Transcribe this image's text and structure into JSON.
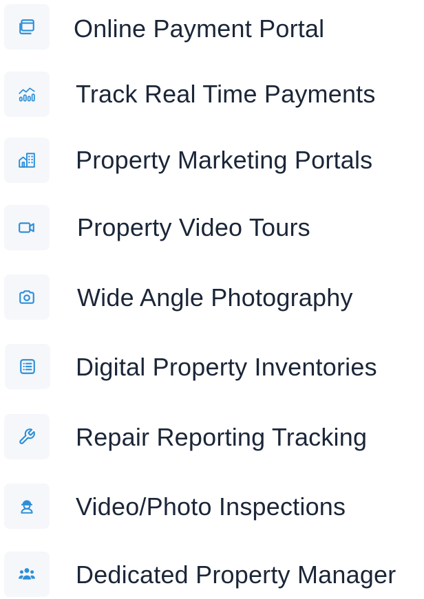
{
  "accent_color": "#2d8fd8",
  "features": [
    {
      "label": "Online Payment Portal",
      "icon": "browser-window-icon"
    },
    {
      "label": "Track Real Time Payments",
      "icon": "analytics-chart-icon"
    },
    {
      "label": "Property Marketing Portals",
      "icon": "buildings-icon"
    },
    {
      "label": "Property Video Tours",
      "icon": "video-camera-icon"
    },
    {
      "label": "Wide Angle Photography",
      "icon": "camera-icon"
    },
    {
      "label": "Digital Property Inventories",
      "icon": "checklist-icon"
    },
    {
      "label": "Repair Reporting Tracking",
      "icon": "wrench-icon"
    },
    {
      "label": "Video/Photo Inspections",
      "icon": "hard-hat-worker-icon"
    },
    {
      "label": "Dedicated Property Manager",
      "icon": "team-users-icon"
    }
  ]
}
